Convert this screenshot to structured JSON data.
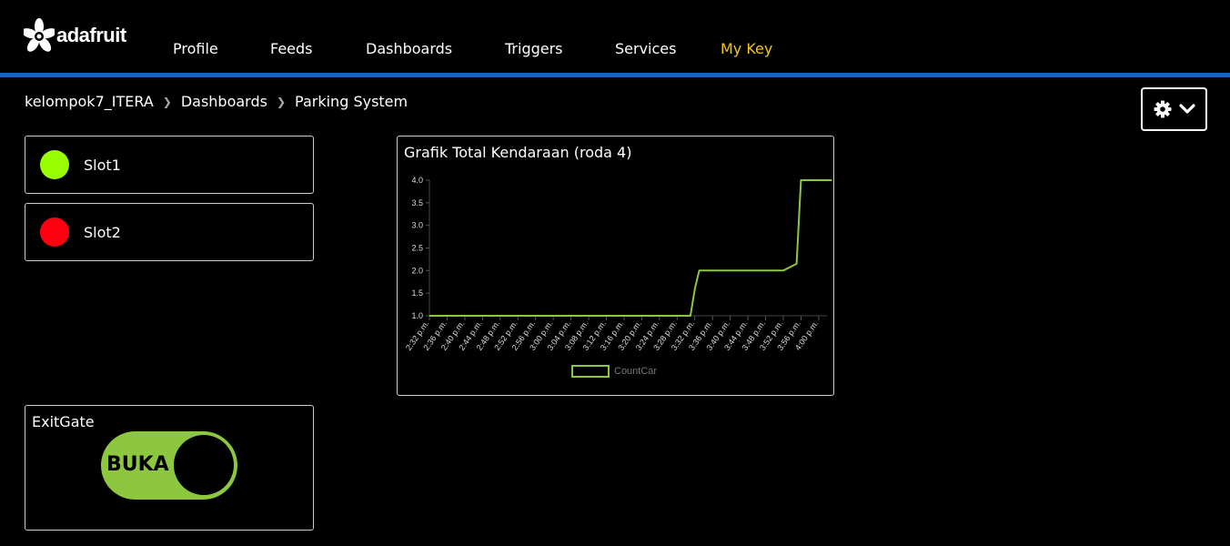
{
  "header": {
    "logo_text": "adafruit",
    "nav": [
      {
        "label": "Profile"
      },
      {
        "label": "Feeds"
      },
      {
        "label": "Dashboards"
      },
      {
        "label": "Triggers"
      },
      {
        "label": "Services"
      },
      {
        "label": "My Key"
      }
    ],
    "accent_color": "#1565c0",
    "key_color": "#f5c518"
  },
  "breadcrumb": [
    "kelompok7_ITERA",
    "Dashboards",
    "Parking System"
  ],
  "settings_button": {
    "icons": [
      "gear-icon",
      "chevron-down-icon"
    ]
  },
  "blocks": {
    "slot1": {
      "label": "Slot1",
      "color": "#99ff00"
    },
    "slot2": {
      "label": "Slot2",
      "color": "#ff0011"
    },
    "exit_gate": {
      "title": "ExitGate",
      "toggle_label": "BUKA",
      "toggle_color": "#8dc63f",
      "state": "on"
    }
  },
  "chart_data": {
    "type": "line",
    "title": "Grafik Total Kendaraan (roda 4)",
    "xlabel": "",
    "ylabel": "",
    "ylim": [
      1.0,
      4.0
    ],
    "yticks": [
      "1.0",
      "1.5",
      "2.0",
      "2.5",
      "3.0",
      "3.5",
      "4.0"
    ],
    "xticks": [
      "2:32 p.m.",
      "2:36 p.m.",
      "2:40 p.m.",
      "2:44 p.m.",
      "2:48 p.m.",
      "2:52 p.m.",
      "2:56 p.m.",
      "3:00 p.m.",
      "3:04 p.m.",
      "3:08 p.m.",
      "3:12 p.m.",
      "3:16 p.m.",
      "3:20 p.m.",
      "3:24 p.m.",
      "3:28 p.m.",
      "3:32 p.m.",
      "3:36 p.m.",
      "3:40 p.m.",
      "3:44 p.m.",
      "3:48 p.m.",
      "3:52 p.m.",
      "3:56 p.m.",
      "4:00 p.m."
    ],
    "series": [
      {
        "name": "CountCar",
        "color": "#8dc63f",
        "x": [
          "2:32 p.m.",
          "3:31 p.m.",
          "3:32 p.m.",
          "3:33 p.m.",
          "3:52 p.m.",
          "3:55 p.m.",
          "3:56 p.m.",
          "4:03 p.m."
        ],
        "values": [
          1,
          1,
          1.6,
          2,
          2,
          2.15,
          4,
          4
        ]
      }
    ],
    "legend": "bottom",
    "grid": false
  }
}
